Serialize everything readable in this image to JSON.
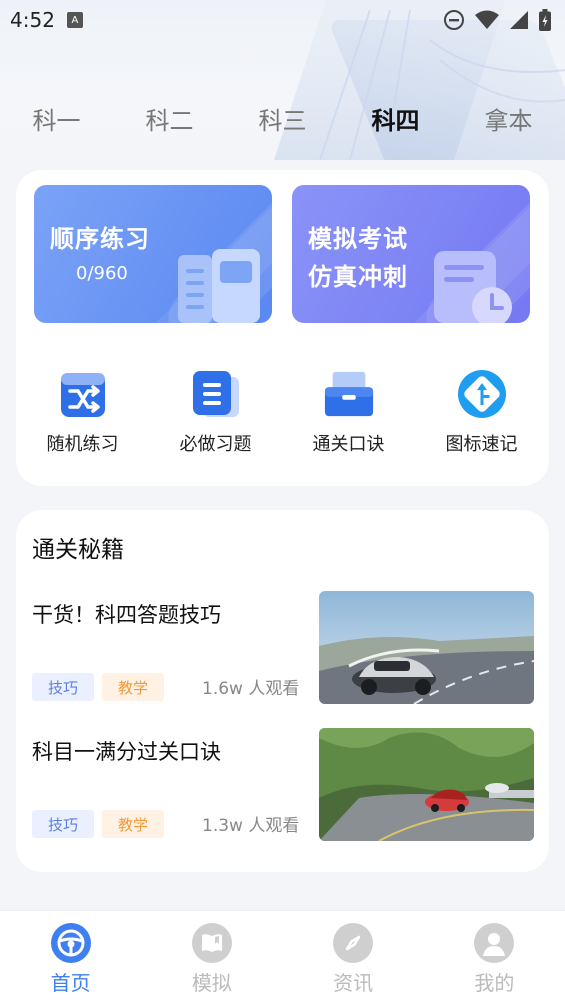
{
  "status_bar": {
    "time": "4:52",
    "notification_letter": "A",
    "icons": [
      "dnd-icon",
      "wifi-icon",
      "signal-icon",
      "battery-icon"
    ]
  },
  "tabs": [
    {
      "label": "科一",
      "active": false
    },
    {
      "label": "科二",
      "active": false
    },
    {
      "label": "科三",
      "active": false
    },
    {
      "label": "科四",
      "active": true
    },
    {
      "label": "拿本",
      "active": false
    }
  ],
  "practice": {
    "sequential": {
      "title": "顺序练习",
      "progress": "0/960"
    },
    "mock_exam": {
      "title_line1": "模拟考试",
      "title_line2": "仿真冲刺"
    }
  },
  "shortcuts": [
    {
      "label": "随机练习",
      "icon": "shuffle-icon"
    },
    {
      "label": "必做习题",
      "icon": "list-icon"
    },
    {
      "label": "通关口诀",
      "icon": "cabinet-icon"
    },
    {
      "label": "图标速记",
      "icon": "road-sign-icon"
    }
  ],
  "tips_section": {
    "title": "通关秘籍",
    "articles": [
      {
        "title": "干货！科四答题技巧",
        "tags": [
          "技巧",
          "教学"
        ],
        "views": "1.6w 人观看",
        "thumb": "sports-car-on-mountain-road"
      },
      {
        "title": "科目一满分过关口诀",
        "tags": [
          "技巧",
          "教学"
        ],
        "views": "1.3w 人观看",
        "thumb": "red-car-on-forest-road"
      }
    ]
  },
  "bottom_nav": [
    {
      "label": "首页",
      "icon": "steering-wheel-icon",
      "active": true
    },
    {
      "label": "模拟",
      "icon": "book-icon",
      "active": false
    },
    {
      "label": "资讯",
      "icon": "compass-icon",
      "active": false
    },
    {
      "label": "我的",
      "icon": "user-icon",
      "active": false
    }
  ],
  "colors": {
    "accent": "#3f7ff0",
    "seq_card": "#5b87f2",
    "mock_card": "#7479f2",
    "tag_blue_bg": "#eaf0ff",
    "tag_orange_bg": "#fff2e4"
  }
}
